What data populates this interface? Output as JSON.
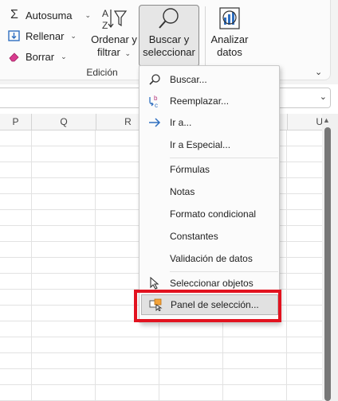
{
  "ribbon": {
    "autosuma_label": "Autosuma",
    "rellenar_label": "Rellenar",
    "borrar_label": "Borrar",
    "ordenar_label_line1": "Ordenar y",
    "ordenar_label_line2": "filtrar",
    "buscar_label_line1": "Buscar y",
    "buscar_label_line2": "seleccionar",
    "analizar_label_line1": "Analizar",
    "analizar_label_line2": "datos",
    "group_label": "Edición"
  },
  "columns": [
    "P",
    "Q",
    "R",
    "U"
  ],
  "menu": {
    "items": [
      {
        "label": "Buscar...",
        "icon": "magnifier-icon"
      },
      {
        "label": "Reemplazar...",
        "icon": "replace-icon"
      },
      {
        "label": "Ir a...",
        "icon": "arrow-right-icon"
      },
      {
        "label": "Ir a Especial...",
        "icon": ""
      },
      {
        "label": "Fórmulas",
        "icon": ""
      },
      {
        "label": "Notas",
        "icon": ""
      },
      {
        "label": "Formato condicional",
        "icon": ""
      },
      {
        "label": "Constantes",
        "icon": ""
      },
      {
        "label": "Validación de datos",
        "icon": ""
      },
      {
        "label": "Seleccionar objetos",
        "icon": "cursor-icon"
      },
      {
        "label": "Panel de selección...",
        "icon": "selection-pane-icon"
      }
    ],
    "highlighted_index": 10
  },
  "colors": {
    "highlight_box": "#e2121f",
    "icon_blue": "#2f6fc0",
    "icon_purple": "#b3337a"
  }
}
